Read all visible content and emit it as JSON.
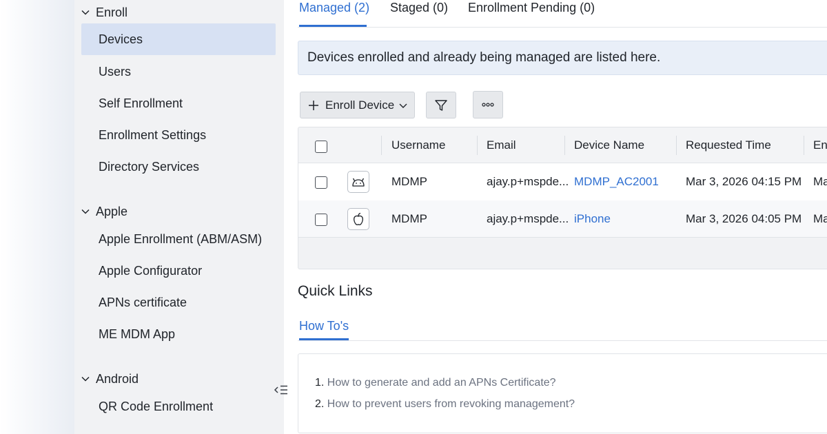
{
  "sidebar": {
    "groups": [
      {
        "label": "Enroll",
        "items": [
          {
            "label": "Devices",
            "active": true
          },
          {
            "label": "Users"
          },
          {
            "label": "Self Enrollment"
          },
          {
            "label": "Enrollment Settings"
          },
          {
            "label": "Directory Services"
          }
        ]
      },
      {
        "label": "Apple",
        "items": [
          {
            "label": "Apple Enrollment (ABM/ASM)"
          },
          {
            "label": "Apple Configurator"
          },
          {
            "label": "APNs certificate"
          },
          {
            "label": "ME MDM App"
          }
        ]
      },
      {
        "label": "Android",
        "items": [
          {
            "label": "QR Code Enrollment"
          }
        ]
      }
    ],
    "collapse_icon": "collapse-sidebar-icon"
  },
  "tabs": [
    {
      "label": "Managed (2)",
      "active": true
    },
    {
      "label": "Staged (0)"
    },
    {
      "label": "Enrollment Pending (0)"
    }
  ],
  "banner": {
    "text": "Devices enrolled and already being managed are listed here."
  },
  "toolbar": {
    "enroll_label": "Enroll Device",
    "enroll_icon": "plus-icon",
    "filter_icon": "filter-icon",
    "more_icon": "more-icon"
  },
  "table": {
    "columns": [
      "Username",
      "Email",
      "Device Name",
      "Requested Time",
      "En"
    ],
    "rows": [
      {
        "os_icon": "android-icon",
        "username": "MDMP",
        "email": "ajay.p+mspde...",
        "device_name": "MDMP_AC2001",
        "requested_time": "Mar 3, 2026 04:15 PM",
        "enrolled": "Ma"
      },
      {
        "os_icon": "apple-icon",
        "username": "MDMP",
        "email": "ajay.p+mspde...",
        "device_name": "iPhone",
        "requested_time": "Mar 3, 2026 04:05 PM",
        "enrolled": "Ma"
      }
    ]
  },
  "quick_links": {
    "title": "Quick Links",
    "tab_label": "How To's",
    "items": [
      {
        "num": "1.",
        "text": "How to generate and add an APNs Certificate?"
      },
      {
        "num": "2.",
        "text": "How to prevent users from revoking management?"
      }
    ]
  },
  "colors": {
    "accent": "#2f6fd1",
    "sidebar_bg": "#f1f2f4",
    "active_item_bg": "#d7e1f3",
    "banner_bg": "#e9eff8"
  }
}
